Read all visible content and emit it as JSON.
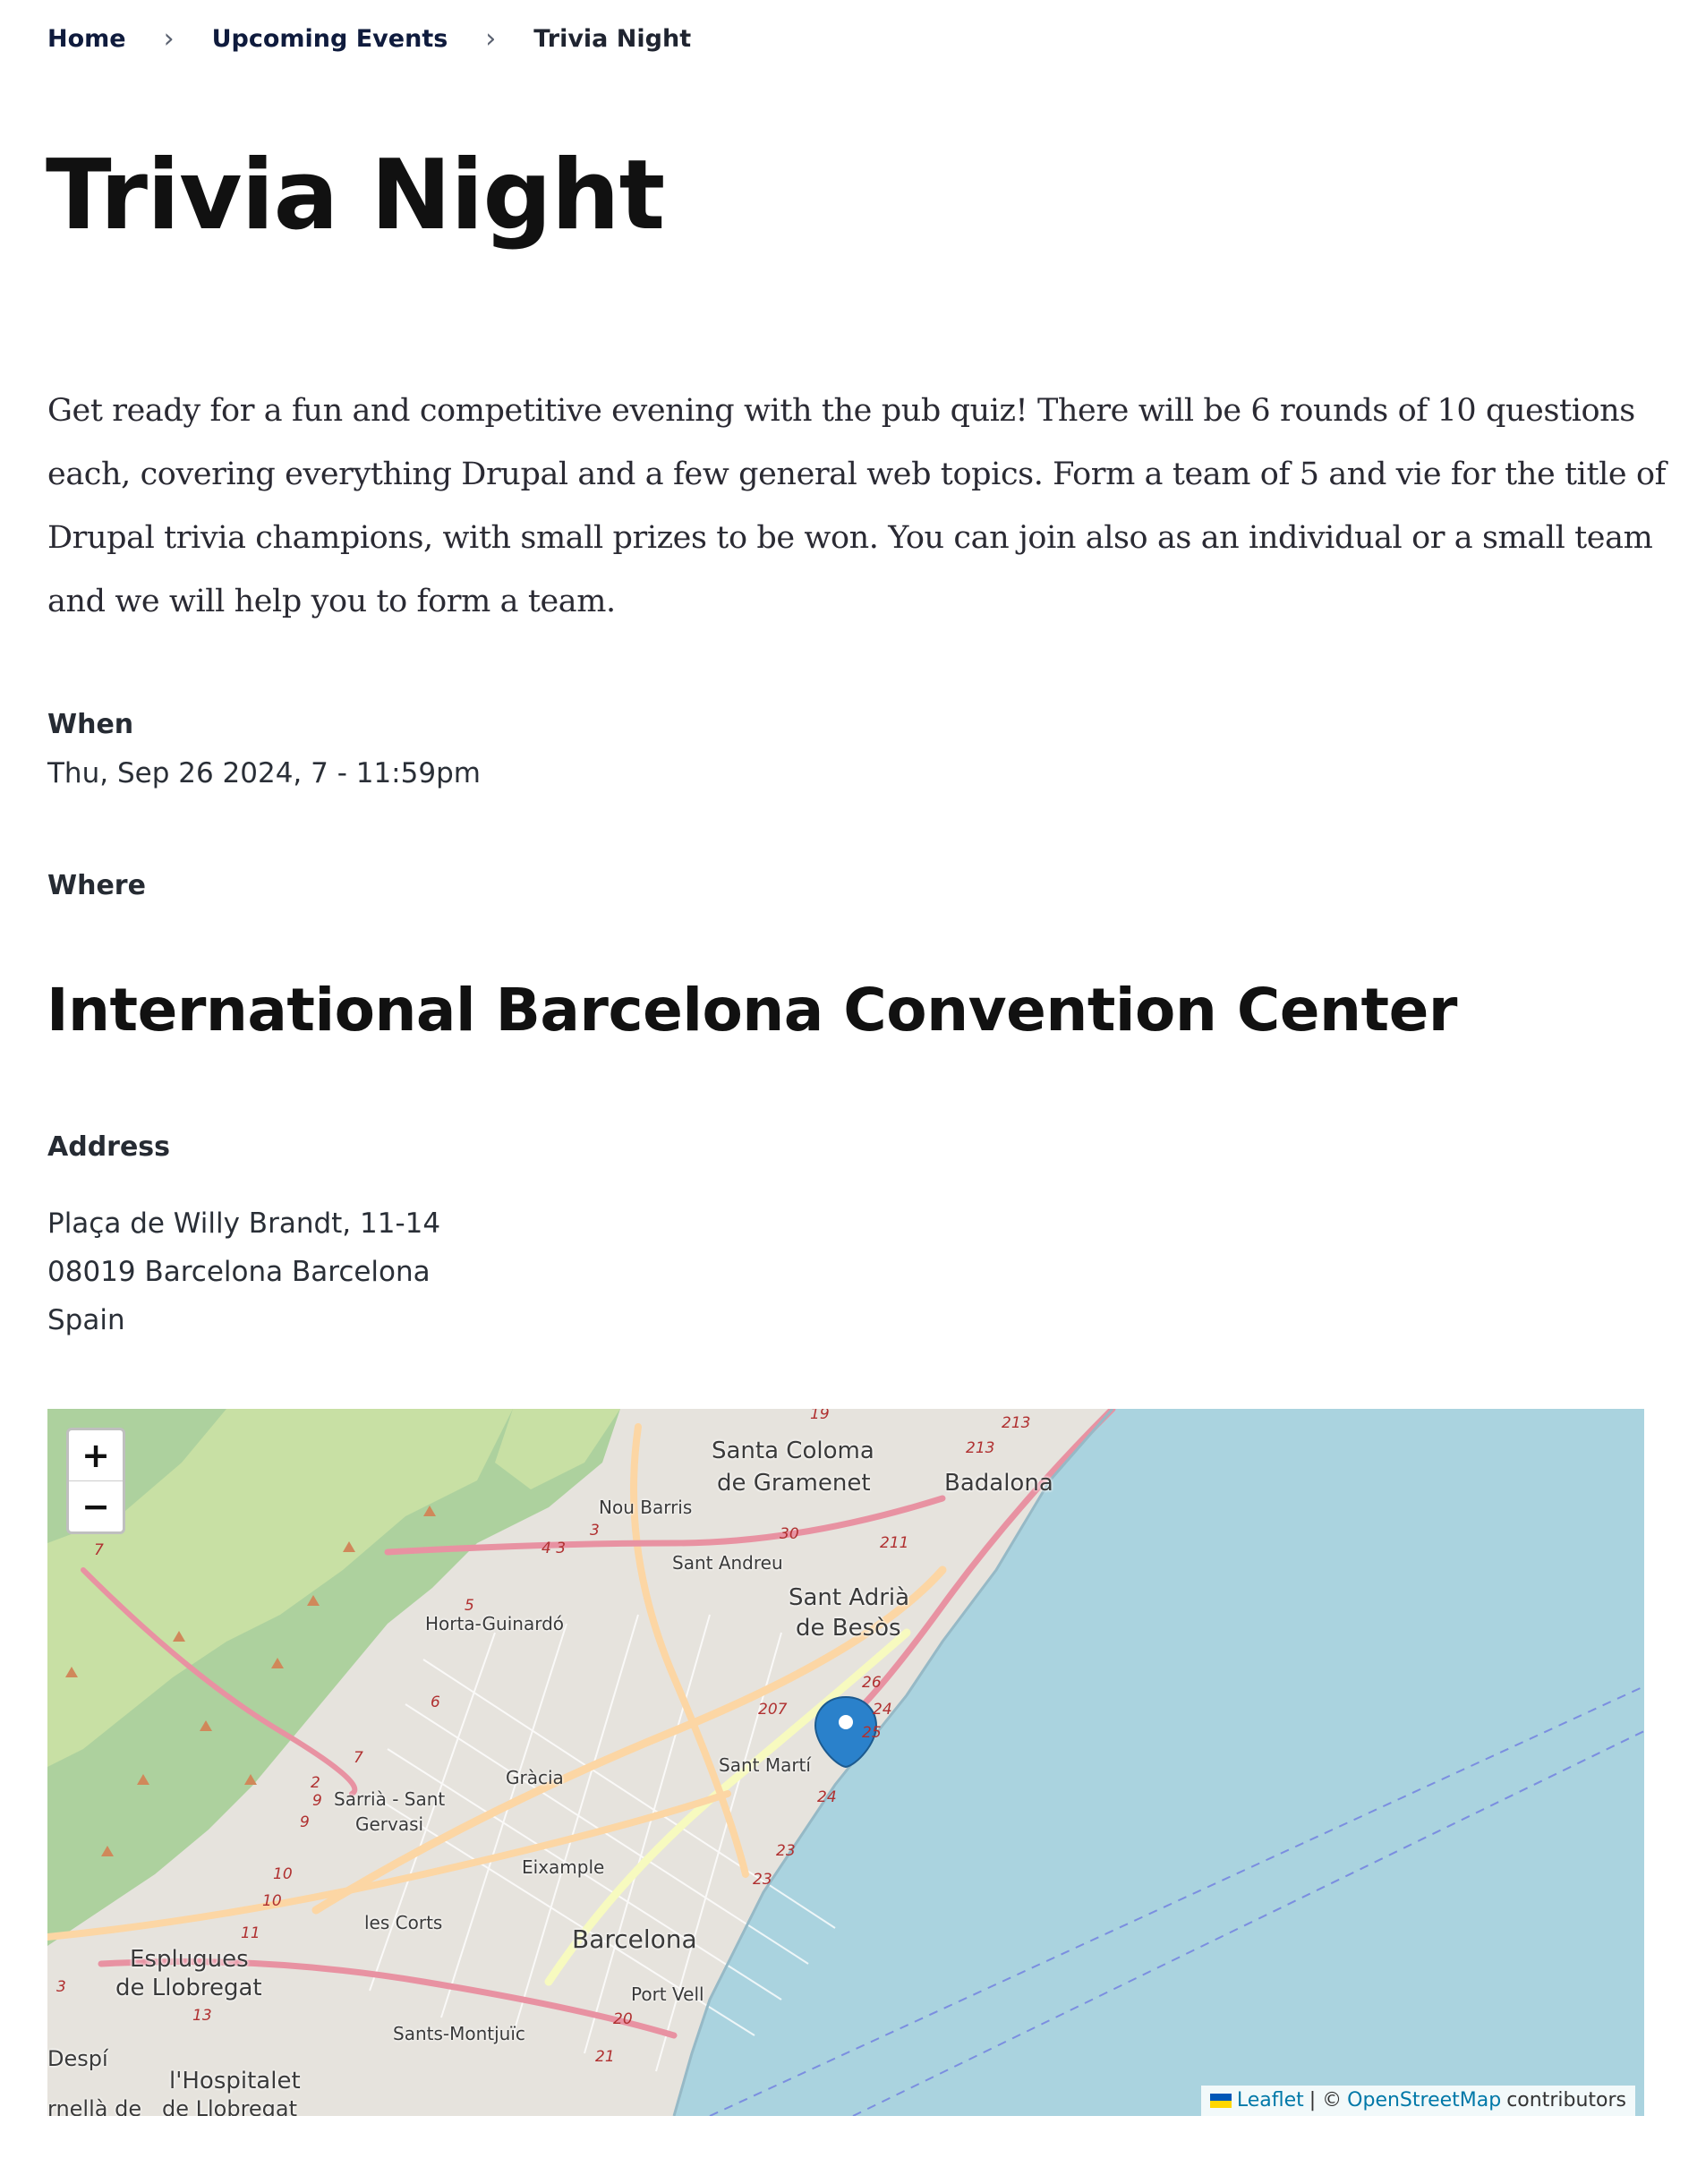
{
  "breadcrumb": {
    "home": "Home",
    "upcoming": "Upcoming Events",
    "current": "Trivia Night",
    "separator": ">"
  },
  "event": {
    "title": "Trivia Night",
    "description": "Get ready for a fun and competitive evening with the pub quiz! There will be 6 rounds of 10 questions each, covering everything Drupal and a few general web topics. Form a team of 5 and vie for the title of Drupal trivia champions, with small prizes to be won. You can join also as an individual or a small team and we will help you to form a team.",
    "when_label": "When",
    "when_value": "Thu, Sep 26 2024, 7 - 11:59pm",
    "where_label": "Where",
    "venue": "International Barcelona Convention Center",
    "address_label": "Address",
    "address_lines": [
      "Plaça de Willy Brandt, 11-14",
      "08019 Barcelona Barcelona",
      "Spain"
    ]
  },
  "map": {
    "zoom_in": "+",
    "zoom_out": "−",
    "attribution_leaflet": "Leaflet",
    "attribution_sep": "| ©",
    "attribution_osm": "OpenStreetMap",
    "attribution_suffix": "contributors",
    "place_labels": {
      "santa_coloma_1": "Santa Coloma",
      "santa_coloma_2": "de Gramenet",
      "badalona": "Badalona",
      "nou_barris": "Nou Barris",
      "sant_andreu": "Sant Andreu",
      "sant_adria_1": "Sant Adrià",
      "sant_adria_2": "de Besòs",
      "horta": "Horta-Guinardó",
      "sant_marti": "Sant Martí",
      "gracia": "Gràcia",
      "sarria_1": "Sarrià - Sant",
      "sarria_2": "Gervasi",
      "eixample": "Eixample",
      "les_corts": "les Corts",
      "barcelona": "Barcelona",
      "esplugues_1": "Esplugues",
      "esplugues_2": "de Llobregat",
      "port_vell": "Port Vell",
      "sants": "Sants-Montjuïc",
      "hospitalet": "l'Hospitalet",
      "hospitalet_2": "rnellà de   de Llobregat",
      "despi": "Despí"
    },
    "road_numbers": [
      "213",
      "213",
      "19",
      "30",
      "211",
      "3",
      "4 3",
      "5",
      "6",
      "26",
      "24",
      "25",
      "207",
      "24",
      "23",
      "23",
      "7",
      "2",
      "9",
      "9",
      "10",
      "10",
      "11",
      "13",
      "20",
      "21",
      "3",
      "7"
    ],
    "colors": {
      "water": "#aad3df",
      "urban": "#e6e3dd",
      "park": "#c8e0a4",
      "forest": "#add19e",
      "primary_road": "#fcd6a4",
      "secondary_road": "#f7fabf",
      "motorway": "#e892a2",
      "marker": "#2a81cb"
    }
  }
}
